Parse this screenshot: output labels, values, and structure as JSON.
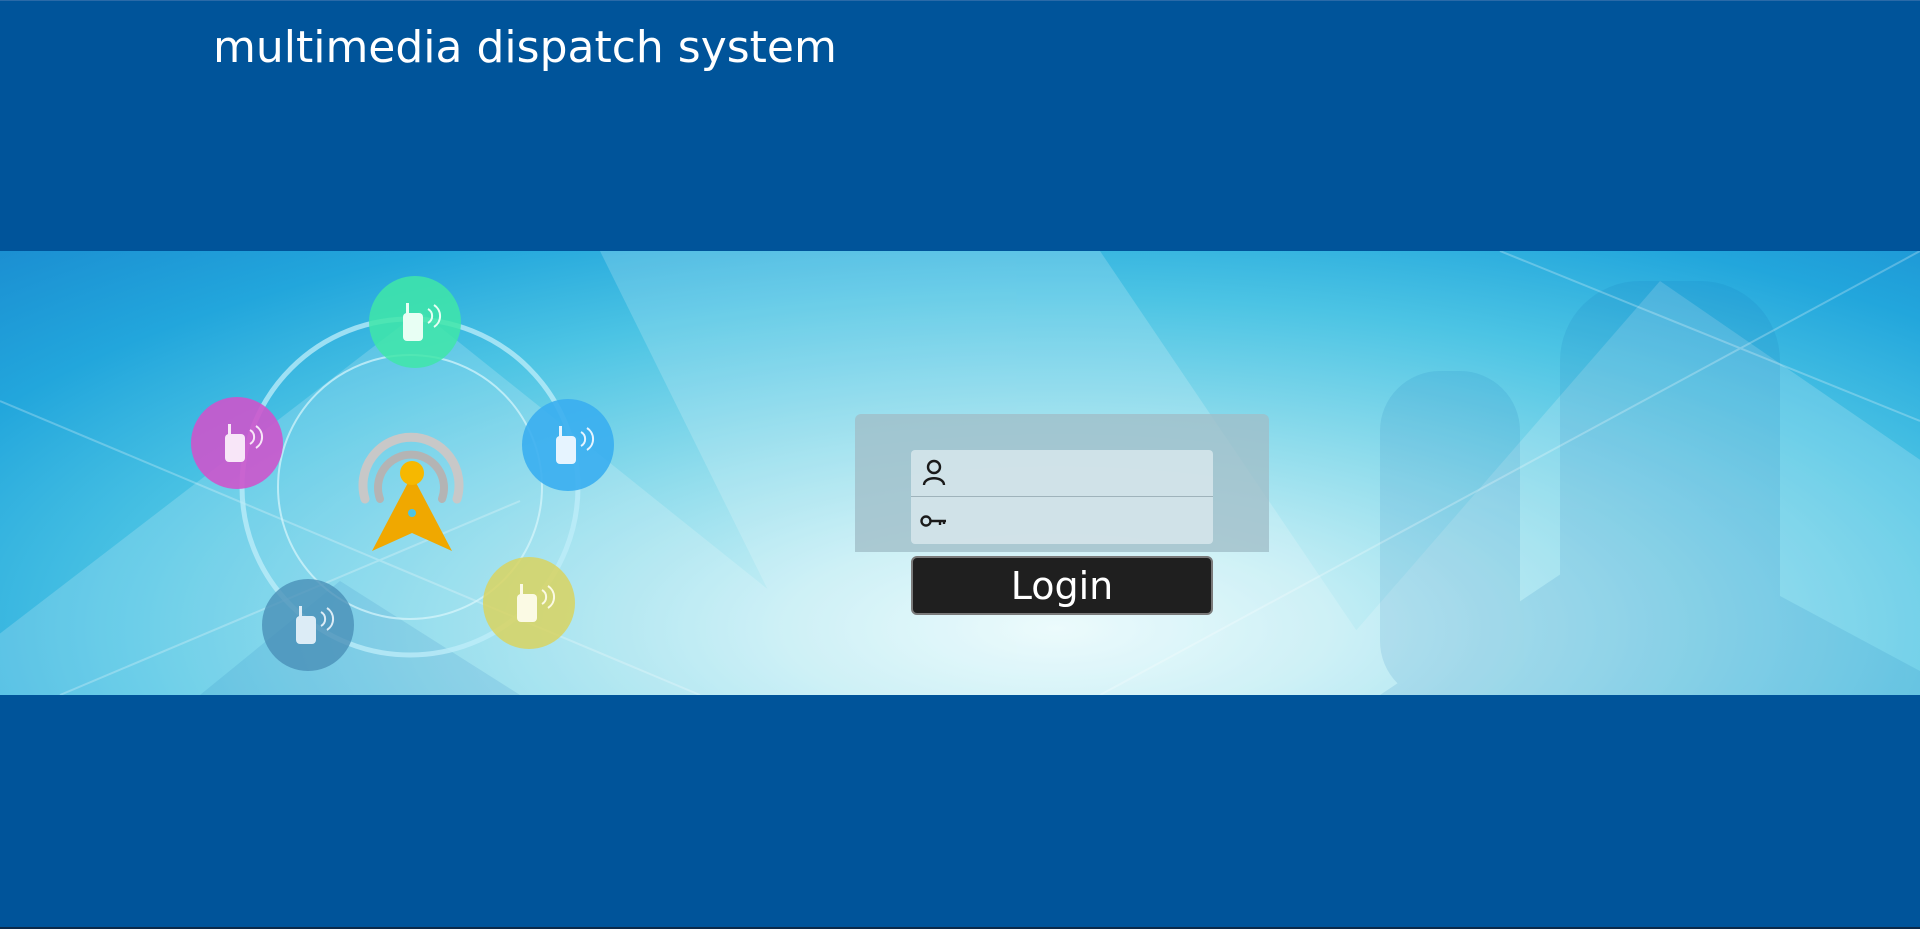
{
  "app": {
    "title": "multimedia dispatch system"
  },
  "login": {
    "username_value": "",
    "username_placeholder": "",
    "password_value": "",
    "password_placeholder": "",
    "button_label": "Login"
  },
  "icons": {
    "username": "user-icon",
    "password": "key-icon",
    "tower": "radio-tower-icon",
    "radio": "walkie-talkie-icon"
  },
  "colors": {
    "page_background": "#00549a",
    "button_background": "#1f1f1f",
    "tower_accent": "#f0a800"
  }
}
